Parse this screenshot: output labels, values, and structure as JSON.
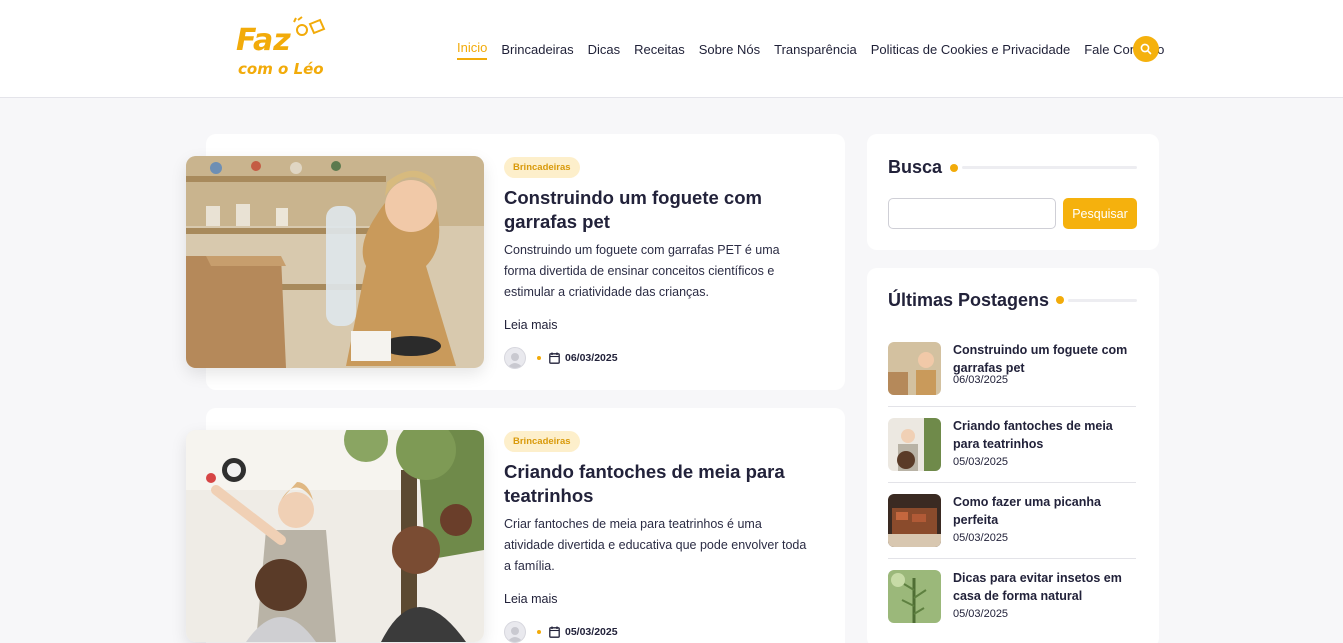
{
  "brand": {
    "logo_text_top": "Faz",
    "logo_text_bottom": "com o Léo",
    "accent": "#f2ab0a"
  },
  "nav": {
    "items": [
      {
        "label": "Inicio",
        "active": true
      },
      {
        "label": "Brincadeiras"
      },
      {
        "label": "Dicas"
      },
      {
        "label": "Receitas"
      },
      {
        "label": "Sobre Nós"
      },
      {
        "label": "Transparência"
      },
      {
        "label": "Politicas de Cookies e Privacidade"
      },
      {
        "label": "Fale Conosco"
      }
    ],
    "search_icon": "search-icon"
  },
  "posts": [
    {
      "category": "Brincadeiras",
      "title": "Construindo um foguete com garrafas pet",
      "excerpt": "Construindo um foguete com garrafas PET é uma forma divertida de ensinar conceitos científicos e estimular a criatividade das crianças.",
      "read_more": "Leia mais",
      "date": "06/03/2025"
    },
    {
      "category": "Brincadeiras",
      "title": "Criando fantoches de meia para teatrinhos",
      "excerpt": "Criar fantoches de meia para teatrinhos é uma atividade divertida e educativa que pode envolver toda a família.",
      "read_more": "Leia mais",
      "date": "05/03/2025"
    }
  ],
  "sidebar": {
    "search": {
      "title": "Busca",
      "input_value": "",
      "button_label": "Pesquisar"
    },
    "recent": {
      "title": "Últimas Postagens",
      "items": [
        {
          "title": "Construindo um foguete com garrafas pet",
          "date": "06/03/2025"
        },
        {
          "title": "Criando fantoches de meia para teatrinhos",
          "date": "05/03/2025"
        },
        {
          "title": "Como fazer uma picanha perfeita",
          "date": "05/03/2025"
        },
        {
          "title": "Dicas para evitar insetos em casa de forma natural",
          "date": "05/03/2025"
        }
      ]
    }
  }
}
